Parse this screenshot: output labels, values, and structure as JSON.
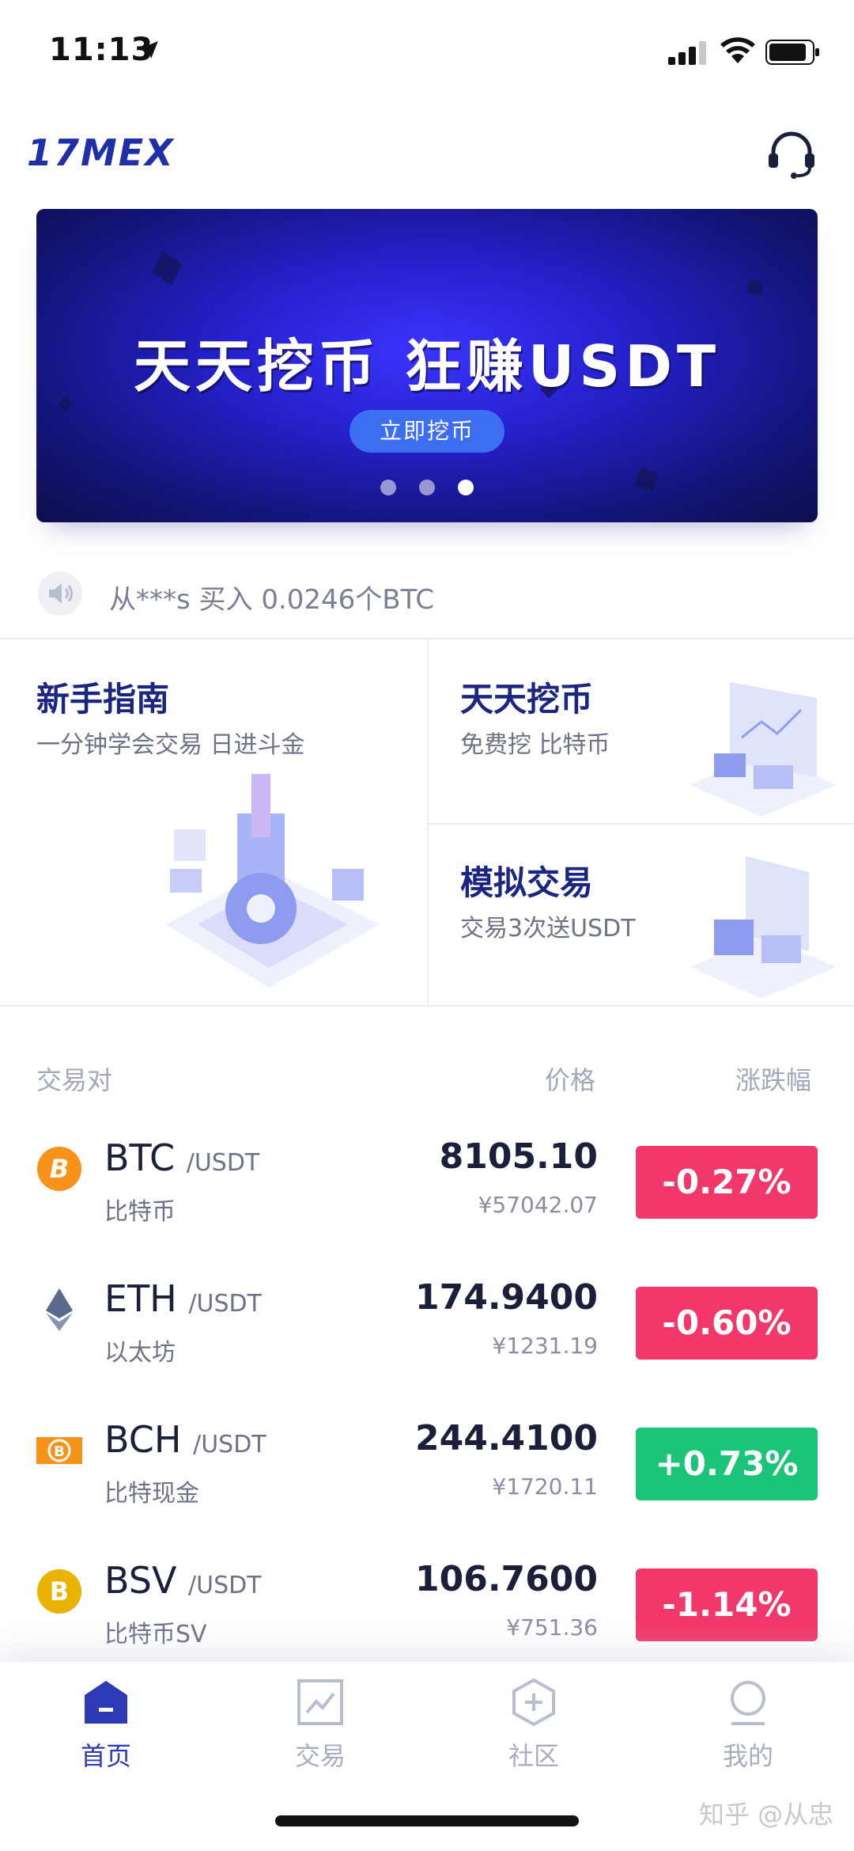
{
  "status_bar": {
    "time": "11:13"
  },
  "header": {
    "logo": "17MEX"
  },
  "banner": {
    "title": "天天挖币 狂赚USDT",
    "button": "立即挖币",
    "slide_count": 3,
    "active_slide": 3
  },
  "ticker": {
    "text": "从***s 买入 0.0246个BTC"
  },
  "features": {
    "guide": {
      "title": "新手指南",
      "subtitle": "一分钟学会交易 日进斗金"
    },
    "mining": {
      "title": "天天挖币",
      "subtitle": "免费挖 比特币"
    },
    "simulate": {
      "title": "模拟交易",
      "subtitle": "交易3次送USDT"
    }
  },
  "market": {
    "columns": [
      "交易对",
      "价格",
      "涨跌幅"
    ],
    "rows": [
      {
        "symbol": "BTC",
        "quote": "/USDT",
        "name": "比特币",
        "price": "8105.10",
        "cny": "¥57042.07",
        "change": "-0.27%",
        "direction": "down"
      },
      {
        "symbol": "ETH",
        "quote": "/USDT",
        "name": "以太坊",
        "price": "174.9400",
        "cny": "¥1231.19",
        "change": "-0.60%",
        "direction": "down"
      },
      {
        "symbol": "BCH",
        "quote": "/USDT",
        "name": "比特现金",
        "price": "244.4100",
        "cny": "¥1720.11",
        "change": "+0.73%",
        "direction": "up"
      },
      {
        "symbol": "BSV",
        "quote": "/USDT",
        "name": "比特币SV",
        "price": "106.7600",
        "cny": "¥751.36",
        "change": "-1.14%",
        "direction": "down"
      }
    ]
  },
  "tabs": [
    {
      "label": "首页",
      "icon": "home-icon",
      "active": true
    },
    {
      "label": "交易",
      "icon": "chart-icon",
      "active": false
    },
    {
      "label": "社区",
      "icon": "hexagon-plus-icon",
      "active": false
    },
    {
      "label": "我的",
      "icon": "user-icon",
      "active": false
    }
  ],
  "watermark": "知乎 @从忠",
  "colors": {
    "brand": "#1f2fa8",
    "down": "#f2386a",
    "up": "#1cc47a",
    "tab_active": "#2c3ab5"
  }
}
